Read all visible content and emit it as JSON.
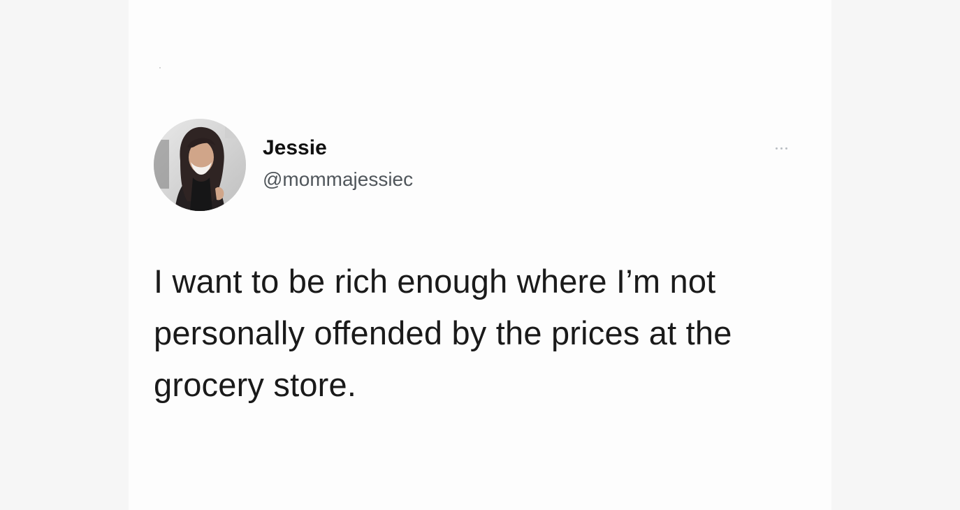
{
  "tweet": {
    "display_name": "Jessie",
    "handle": "@mommajessiec",
    "text": "I want to be rich enough where I’m not personally offended by the prices at the grocery store.",
    "more_icon": "more-horizontal-icon"
  },
  "colors": {
    "background": "#f6f6f6",
    "card": "#fdfdfd",
    "name": "#111111",
    "handle": "#50565b",
    "text": "#1a1a1a"
  }
}
